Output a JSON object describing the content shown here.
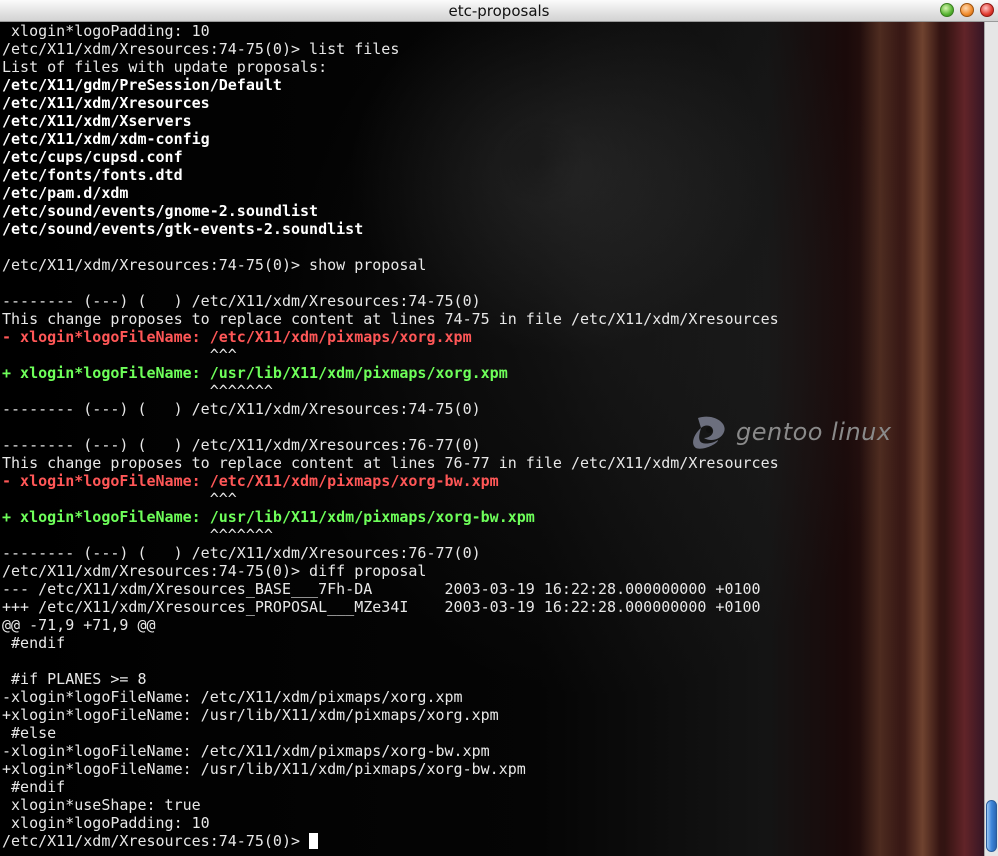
{
  "window": {
    "title": "etc-proposals",
    "buttons": {
      "minimize": "minimize-icon",
      "maximize": "maximize-icon",
      "close": "close-icon"
    }
  },
  "logo": {
    "text": "gentoo linux"
  },
  "terminal": {
    "lines": [
      {
        "text": " xlogin*logoPadding: 10",
        "style": "normal"
      },
      {
        "text": "/etc/X11/xdm/Xresources:74-75(0)> list files",
        "style": "normal"
      },
      {
        "text": "List of files with update proposals:",
        "style": "normal"
      },
      {
        "text": "/etc/X11/gdm/PreSession/Default",
        "style": "bold"
      },
      {
        "text": "/etc/X11/xdm/Xresources",
        "style": "bold"
      },
      {
        "text": "/etc/X11/xdm/Xservers",
        "style": "bold"
      },
      {
        "text": "/etc/X11/xdm/xdm-config",
        "style": "bold"
      },
      {
        "text": "/etc/cups/cupsd.conf",
        "style": "bold"
      },
      {
        "text": "/etc/fonts/fonts.dtd",
        "style": "bold"
      },
      {
        "text": "/etc/pam.d/xdm",
        "style": "bold"
      },
      {
        "text": "/etc/sound/events/gnome-2.soundlist",
        "style": "bold"
      },
      {
        "text": "/etc/sound/events/gtk-events-2.soundlist",
        "style": "bold"
      },
      {
        "text": "",
        "style": "normal"
      },
      {
        "text": "/etc/X11/xdm/Xresources:74-75(0)> show proposal",
        "style": "normal"
      },
      {
        "text": "",
        "style": "normal"
      },
      {
        "text": "-------- (---) (   ) /etc/X11/xdm/Xresources:74-75(0)",
        "style": "normal"
      },
      {
        "text": "This change proposes to replace content at lines 74-75 in file /etc/X11/xdm/Xresources",
        "style": "normal"
      },
      {
        "text": "- xlogin*logoFileName: /etc/X11/xdm/pixmaps/xorg.xpm",
        "style": "removed"
      },
      {
        "text": "                       ^^^",
        "style": "normal"
      },
      {
        "text": "+ xlogin*logoFileName: /usr/lib/X11/xdm/pixmaps/xorg.xpm",
        "style": "added"
      },
      {
        "text": "                       ^^^^^^^",
        "style": "normal"
      },
      {
        "text": "-------- (---) (   ) /etc/X11/xdm/Xresources:74-75(0)",
        "style": "normal"
      },
      {
        "text": "",
        "style": "normal"
      },
      {
        "text": "-------- (---) (   ) /etc/X11/xdm/Xresources:76-77(0)",
        "style": "normal"
      },
      {
        "text": "This change proposes to replace content at lines 76-77 in file /etc/X11/xdm/Xresources",
        "style": "normal"
      },
      {
        "text": "- xlogin*logoFileName: /etc/X11/xdm/pixmaps/xorg-bw.xpm",
        "style": "removed"
      },
      {
        "text": "                       ^^^",
        "style": "normal"
      },
      {
        "text": "+ xlogin*logoFileName: /usr/lib/X11/xdm/pixmaps/xorg-bw.xpm",
        "style": "added"
      },
      {
        "text": "                       ^^^^^^^",
        "style": "normal"
      },
      {
        "text": "-------- (---) (   ) /etc/X11/xdm/Xresources:76-77(0)",
        "style": "normal"
      },
      {
        "text": "/etc/X11/xdm/Xresources:74-75(0)> diff proposal",
        "style": "normal"
      },
      {
        "text": "--- /etc/X11/xdm/Xresources_BASE___7Fh-DA        2003-03-19 16:22:28.000000000 +0100",
        "style": "normal"
      },
      {
        "text": "+++ /etc/X11/xdm/Xresources_PROPOSAL___MZe34I    2003-03-19 16:22:28.000000000 +0100",
        "style": "normal"
      },
      {
        "text": "@@ -71,9 +71,9 @@",
        "style": "normal"
      },
      {
        "text": " #endif",
        "style": "normal"
      },
      {
        "text": "",
        "style": "normal"
      },
      {
        "text": " #if PLANES >= 8",
        "style": "normal"
      },
      {
        "text": "-xlogin*logoFileName: /etc/X11/xdm/pixmaps/xorg.xpm",
        "style": "normal"
      },
      {
        "text": "+xlogin*logoFileName: /usr/lib/X11/xdm/pixmaps/xorg.xpm",
        "style": "normal"
      },
      {
        "text": " #else",
        "style": "normal"
      },
      {
        "text": "-xlogin*logoFileName: /etc/X11/xdm/pixmaps/xorg-bw.xpm",
        "style": "normal"
      },
      {
        "text": "+xlogin*logoFileName: /usr/lib/X11/xdm/pixmaps/xorg-bw.xpm",
        "style": "normal"
      },
      {
        "text": " #endif",
        "style": "normal"
      },
      {
        "text": " xlogin*useShape: true",
        "style": "normal"
      },
      {
        "text": " xlogin*logoPadding: 10",
        "style": "normal"
      }
    ],
    "prompt": "/etc/X11/xdm/Xresources:74-75(0)> "
  },
  "scrollbar": {
    "position": 0.97
  }
}
